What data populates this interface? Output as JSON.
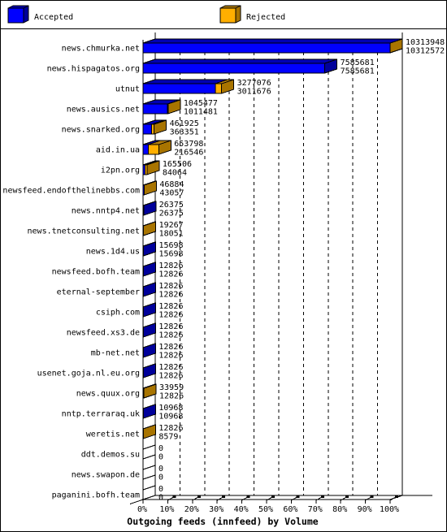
{
  "legend": {
    "items": [
      {
        "label": "Accepted",
        "color": "#0000FF",
        "shade_top": "#0000B4",
        "shade_side": "#00009A"
      },
      {
        "label": "Rejected",
        "color": "#FFAF00",
        "shade_top": "#B07C0C",
        "shade_side": "#A87400"
      }
    ]
  },
  "chart_data": {
    "type": "bar",
    "orientation": "horizontal",
    "stacked": true,
    "style": "3d",
    "title": "Outgoing feeds (innfeed) by Volume",
    "xlabel": "",
    "ylabel": "",
    "grid": true,
    "legend_position": "top",
    "xlim": [
      0,
      10313948
    ],
    "x_ticks": [
      "0%",
      "10%",
      "20%",
      "30%",
      "40%",
      "50%",
      "60%",
      "70%",
      "80%",
      "90%",
      "100%"
    ],
    "categories": [
      "news.chmurka.net",
      "news.hispagatos.org",
      "utnut",
      "news.ausics.net",
      "news.snarked.org",
      "aid.in.ua",
      "i2pn.org",
      "newsfeed.endofthelinebbs.com",
      "news.nntp4.net",
      "news.tnetconsulting.net",
      "news.1d4.us",
      "newsfeed.bofh.team",
      "eternal-september",
      "csiph.com",
      "newsfeed.xs3.de",
      "mb-net.net",
      "usenet.goja.nl.eu.org",
      "news.quux.org",
      "nntp.terraraq.uk",
      "weretis.net",
      "ddt.demos.su",
      "news.swapon.de",
      "paganini.bofh.team"
    ],
    "series": [
      {
        "name": "Accepted",
        "color": "#0000FF",
        "shade_top": "#0000B4",
        "shade_side": "#00009A",
        "values": [
          10312572,
          7585681,
          3011676,
          1011481,
          363351,
          216546,
          84064,
          43057,
          26375,
          18051,
          15698,
          12826,
          12826,
          12826,
          12826,
          12826,
          12826,
          12826,
          10968,
          8579,
          0,
          0,
          0
        ]
      },
      {
        "name": "Rejected",
        "color": "#FFAF00",
        "shade_top": "#B07C0C",
        "shade_side": "#A87400",
        "values": [
          1376,
          0,
          265400,
          33996,
          98574,
          437252,
          81442,
          3827,
          0,
          1216,
          0,
          0,
          0,
          0,
          0,
          0,
          0,
          21133,
          0,
          4247,
          0,
          0,
          0
        ]
      }
    ],
    "value_labels": [
      [
        "10313948",
        "10312572"
      ],
      [
        "7585681",
        "7585681"
      ],
      [
        "3277076",
        "3011676"
      ],
      [
        "1045477",
        "1011481"
      ],
      [
        "461925",
        "363351"
      ],
      [
        "653798",
        "216546"
      ],
      [
        "165506",
        "84064"
      ],
      [
        "46884",
        "43057"
      ],
      [
        "26375",
        "26375"
      ],
      [
        "19267",
        "18051"
      ],
      [
        "15698",
        "15698"
      ],
      [
        "12826",
        "12826"
      ],
      [
        "12826",
        "12826"
      ],
      [
        "12826",
        "12826"
      ],
      [
        "12826",
        "12826"
      ],
      [
        "12826",
        "12826"
      ],
      [
        "12826",
        "12826"
      ],
      [
        "33959",
        "12826"
      ],
      [
        "10968",
        "10968"
      ],
      [
        "12826",
        "8579"
      ],
      [
        "0",
        "0"
      ],
      [
        "0",
        "0"
      ],
      [
        "0",
        "0"
      ]
    ]
  }
}
